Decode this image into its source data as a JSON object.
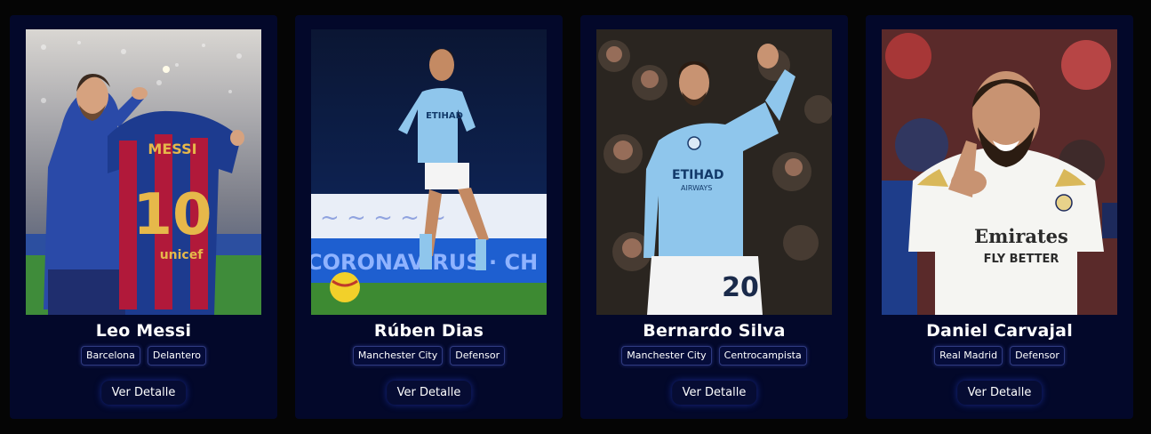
{
  "players": [
    {
      "name": "Leo Messi",
      "club": "Barcelona",
      "position": "Delantero",
      "button_label": "Ver Detalle",
      "jersey_name": "MESSI",
      "jersey_number": "10",
      "sponsor": "unicef"
    },
    {
      "name": "Rúben Dias",
      "club": "Manchester City",
      "position": "Defensor",
      "button_label": "Ver Detalle",
      "sponsor": "ETIHAD",
      "ad_board": "CORONAVIRUS · CH"
    },
    {
      "name": "Bernardo Silva",
      "club": "Manchester City",
      "position": "Centrocampista",
      "button_label": "Ver Detalle",
      "sponsor": "ETIHAD",
      "sponsor_sub": "AIRWAYS",
      "jersey_number": "20"
    },
    {
      "name": "Daniel Carvajal",
      "club": "Real Madrid",
      "position": "Defensor",
      "button_label": "Ver Detalle",
      "sponsor": "Emirates",
      "sponsor_sub": "FLY BETTER"
    }
  ],
  "colors": {
    "page_bg": "#050505",
    "card_bg": "#03082a",
    "tag_border": "#2f3a80",
    "button_glow": "#2846dc"
  }
}
